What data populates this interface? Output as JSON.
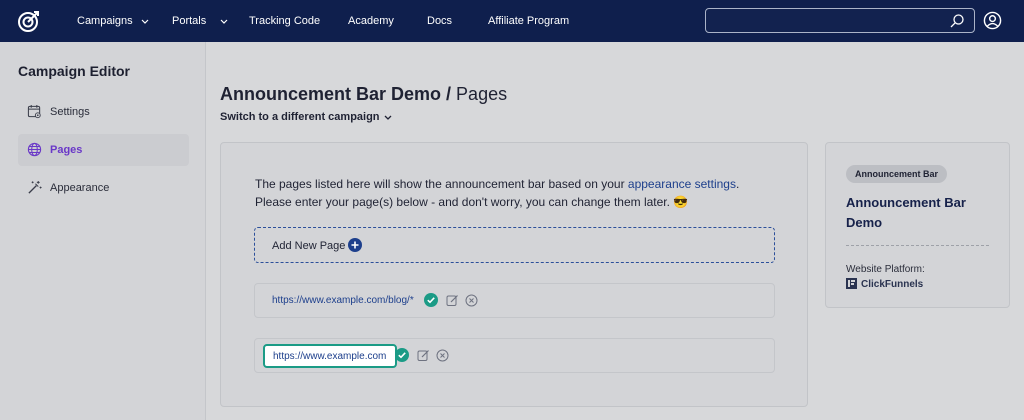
{
  "nav": {
    "items": [
      {
        "label": "Campaigns",
        "dropdown": true
      },
      {
        "label": "Portals",
        "dropdown": true
      },
      {
        "label": "Tracking Code",
        "dropdown": false
      },
      {
        "label": "Academy",
        "dropdown": false
      },
      {
        "label": "Docs",
        "dropdown": false
      },
      {
        "label": "Affiliate Program",
        "dropdown": false
      }
    ],
    "search": {
      "value": "",
      "placeholder": ""
    },
    "icons": {
      "logo": "brand-logo-icon",
      "search": "search-icon",
      "user": "user-circle-icon"
    }
  },
  "sidebar": {
    "title": "Campaign Editor",
    "items": [
      {
        "label": "Settings",
        "icon": "calendar-settings-icon",
        "active": false
      },
      {
        "label": "Pages",
        "icon": "globe-icon",
        "active": true
      },
      {
        "label": "Appearance",
        "icon": "magic-wand-icon",
        "active": false
      }
    ]
  },
  "main": {
    "campaign_name": "Announcement Bar Demo",
    "title_separator": " / ",
    "section": "Pages",
    "switch_label": "Switch to a different campaign",
    "intro_text_before": "The pages listed here will show the announcement bar based on your ",
    "intro_link": "appearance settings",
    "intro_text_after": ".",
    "intro_line2": "Please enter your page(s) below - and don't worry, you can change them later. 😎",
    "add_page_label": "Add New Page",
    "pages": [
      {
        "url": "https://www.example.com/blog/*",
        "editing": false
      },
      {
        "url": "https://www.example.com",
        "editing": true
      }
    ]
  },
  "card": {
    "badge": "Announcement Bar",
    "title": "Announcement Bar Demo",
    "platform_label": "Website Platform:",
    "platform_value": "ClickFunnels"
  },
  "colors": {
    "nav_bg": "#0f1f4d",
    "accent_purple": "#6a38c8",
    "link_blue": "#1d3f8c",
    "confirm_teal": "#1b9b86"
  }
}
